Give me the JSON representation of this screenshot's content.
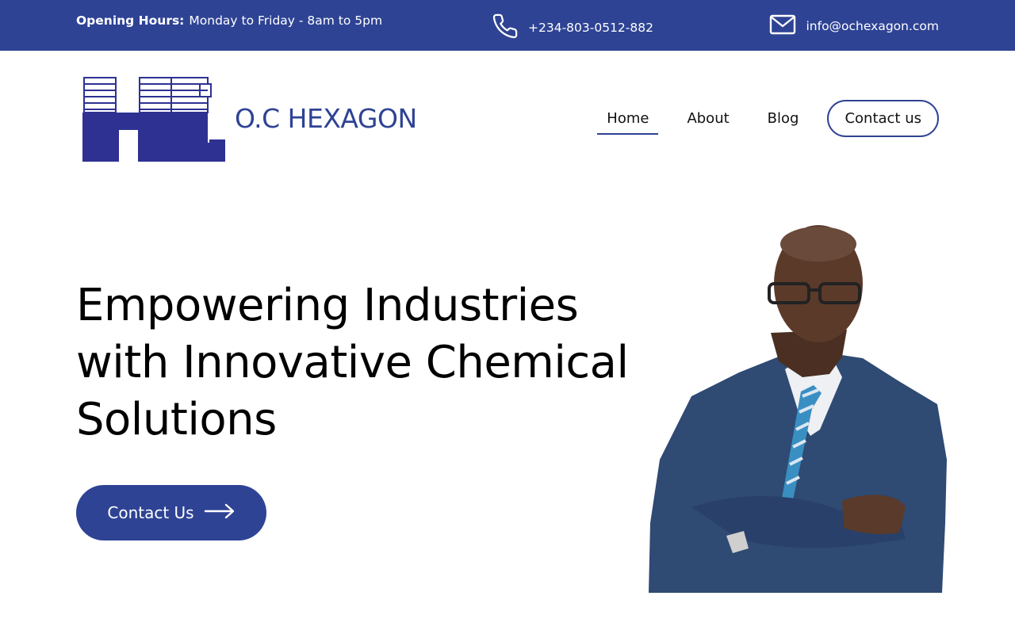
{
  "topbar": {
    "hours_label": "Opening Hours:",
    "hours_value": "Monday to Friday - 8am to 5pm",
    "phone": "+234-803-0512-882",
    "email": "info@ochexagon.com",
    "phone_icon": "phone-icon",
    "email_icon": "mail-icon"
  },
  "brand": {
    "name": "O.C HEXAGON",
    "logo_icon": "hc-logo"
  },
  "nav": {
    "items": [
      "Home",
      "About",
      "Blog"
    ],
    "active": "Home",
    "cta": "Contact us"
  },
  "hero": {
    "title_lines": [
      "Empowering Industries",
      "with Innovative Chemical",
      "Solutions"
    ],
    "button": "Contact Us",
    "button_icon": "arrow-right-icon"
  },
  "colors": {
    "primary": "#2e4394",
    "text": "#111111",
    "background": "#ffffff"
  }
}
